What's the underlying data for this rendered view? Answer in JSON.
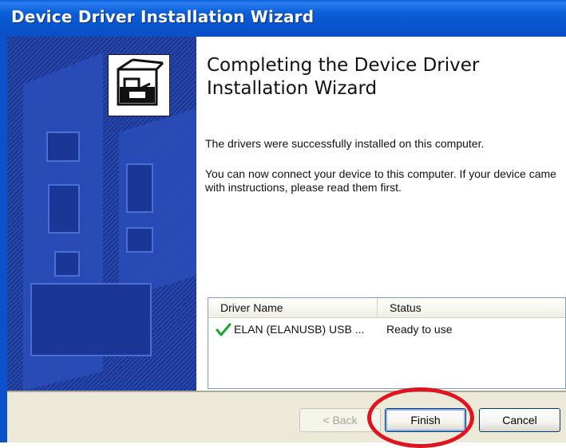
{
  "window": {
    "title": "Device Driver Installation Wizard"
  },
  "banner": {
    "icon": "hardware-driver-icon"
  },
  "content": {
    "heading": "Completing the Device Driver Installation Wizard",
    "message_1": "The drivers were successfully installed on this computer.",
    "message_2": "You can now connect your device to this computer. If your device came with instructions, please read them first."
  },
  "driver_list": {
    "columns": [
      "Driver Name",
      "Status"
    ],
    "rows": [
      {
        "icon": "green-checkmark-icon",
        "name": "ELAN (ELANUSB) USB ...",
        "status": "Ready to use"
      }
    ]
  },
  "buttons": {
    "back": "< Back",
    "finish": "Finish",
    "cancel": "Cancel"
  },
  "colors": {
    "title_bar": "#0a5fd6",
    "banner": "#1c3a98",
    "highlight": "#e0141e",
    "check": "#1aa52a"
  }
}
